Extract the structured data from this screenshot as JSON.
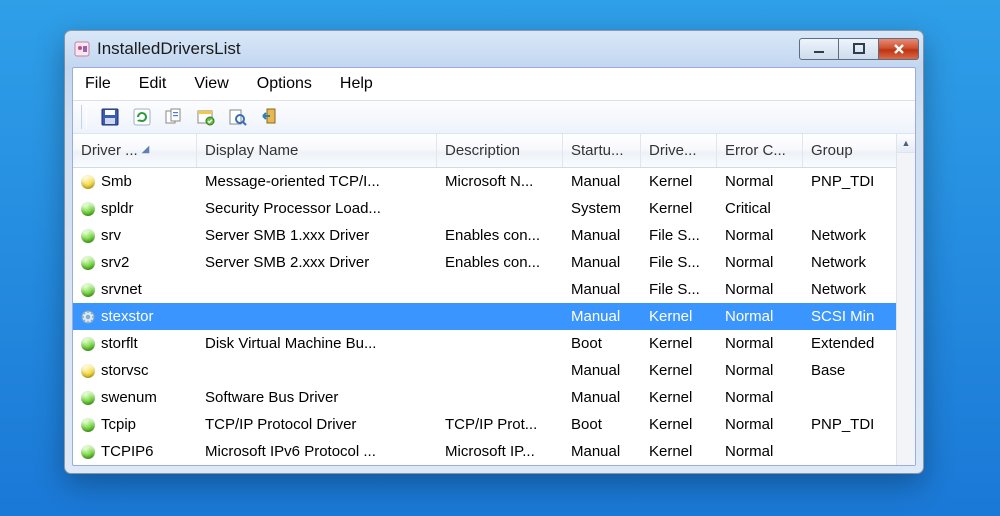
{
  "window": {
    "title": "InstalledDriversList"
  },
  "menu": {
    "items": [
      "File",
      "Edit",
      "View",
      "Options",
      "Help"
    ]
  },
  "toolbar": {
    "icons": [
      "save-icon",
      "refresh-icon",
      "copy-icon",
      "properties-icon",
      "find-icon",
      "exit-icon"
    ]
  },
  "columns": [
    "Driver ...",
    "Display Name",
    "Description",
    "Startu...",
    "Drive...",
    "Error C...",
    "Group"
  ],
  "sort_column": 0,
  "selected_index": 5,
  "rows": [
    {
      "status": "yellow",
      "name": "Smb",
      "display": "Message-oriented TCP/I...",
      "desc": "Microsoft N...",
      "startup": "Manual",
      "drv": "Kernel",
      "error": "Normal",
      "group": "PNP_TDI"
    },
    {
      "status": "green",
      "name": "spldr",
      "display": "Security Processor Load...",
      "desc": "",
      "startup": "System",
      "drv": "Kernel",
      "error": "Critical",
      "group": ""
    },
    {
      "status": "green",
      "name": "srv",
      "display": "Server SMB 1.xxx Driver",
      "desc": "Enables con...",
      "startup": "Manual",
      "drv": "File S...",
      "error": "Normal",
      "group": "Network"
    },
    {
      "status": "green",
      "name": "srv2",
      "display": "Server SMB 2.xxx Driver",
      "desc": "Enables con...",
      "startup": "Manual",
      "drv": "File S...",
      "error": "Normal",
      "group": "Network"
    },
    {
      "status": "green",
      "name": "srvnet",
      "display": "",
      "desc": "",
      "startup": "Manual",
      "drv": "File S...",
      "error": "Normal",
      "group": "Network"
    },
    {
      "status": "gear",
      "name": "stexstor",
      "display": "",
      "desc": "",
      "startup": "Manual",
      "drv": "Kernel",
      "error": "Normal",
      "group": "SCSI Min"
    },
    {
      "status": "green",
      "name": "storflt",
      "display": "Disk Virtual Machine Bu...",
      "desc": "",
      "startup": "Boot",
      "drv": "Kernel",
      "error": "Normal",
      "group": "Extended"
    },
    {
      "status": "yellow",
      "name": "storvsc",
      "display": "",
      "desc": "",
      "startup": "Manual",
      "drv": "Kernel",
      "error": "Normal",
      "group": "Base"
    },
    {
      "status": "green",
      "name": "swenum",
      "display": "Software Bus Driver",
      "desc": "",
      "startup": "Manual",
      "drv": "Kernel",
      "error": "Normal",
      "group": ""
    },
    {
      "status": "green",
      "name": "Tcpip",
      "display": "TCP/IP Protocol Driver",
      "desc": "TCP/IP Prot...",
      "startup": "Boot",
      "drv": "Kernel",
      "error": "Normal",
      "group": "PNP_TDI"
    },
    {
      "status": "green",
      "name": "TCPIP6",
      "display": "Microsoft IPv6 Protocol ...",
      "desc": "Microsoft IP...",
      "startup": "Manual",
      "drv": "Kernel",
      "error": "Normal",
      "group": ""
    }
  ]
}
